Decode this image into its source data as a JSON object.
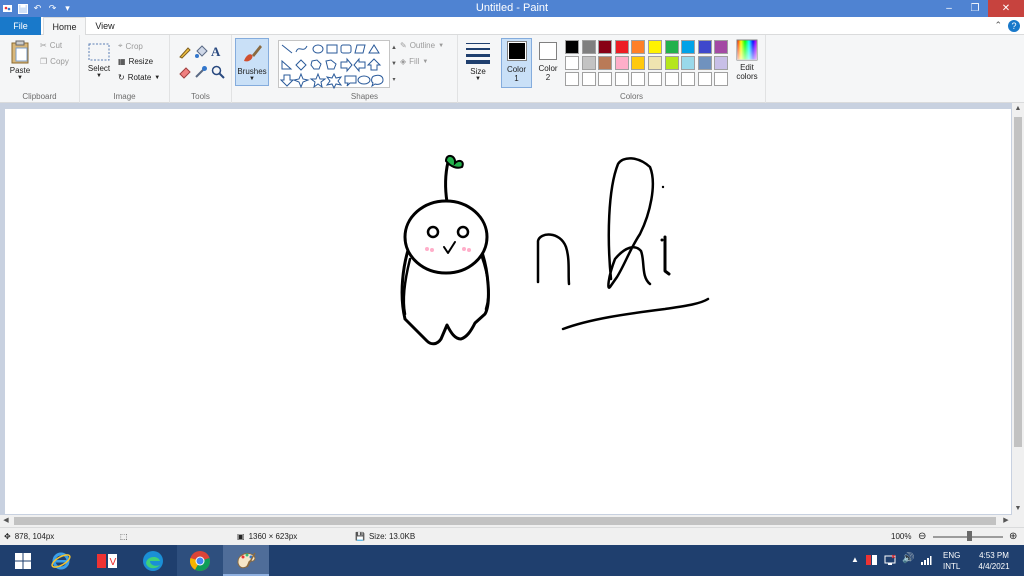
{
  "window": {
    "title": "Untitled - Paint"
  },
  "tabs": {
    "file": "File",
    "home": "Home",
    "view": "View"
  },
  "ribbon": {
    "clipboard": {
      "label": "Clipboard",
      "paste": "Paste",
      "cut": "Cut",
      "copy": "Copy"
    },
    "image": {
      "label": "Image",
      "select": "Select",
      "crop": "Crop",
      "resize": "Resize",
      "rotate": "Rotate"
    },
    "tools": {
      "label": "Tools"
    },
    "brushes": {
      "label": "Brushes"
    },
    "shapes": {
      "label": "Shapes",
      "outline": "Outline",
      "fill": "Fill"
    },
    "size": {
      "label": "Size"
    },
    "colors": {
      "label": "Colors",
      "color1_label": "Color",
      "color1_num": "1",
      "color2_label": "Color",
      "color2_num": "2",
      "color1_value": "#000000",
      "color2_value": "#ffffff",
      "edit_colors_1": "Edit",
      "edit_colors_2": "colors",
      "palette": [
        "#000000",
        "#7f7f7f",
        "#880015",
        "#ed1c24",
        "#ff7f27",
        "#fff200",
        "#22b14c",
        "#00a2e8",
        "#3f48cc",
        "#a349a4",
        "#ffffff",
        "#c3c3c3",
        "#b97a57",
        "#ffaec9",
        "#ffc90e",
        "#efe4b0",
        "#b5e61d",
        "#99d9ea",
        "#7092be",
        "#c8bfe7",
        "#ffffff",
        "#ffffff",
        "#ffffff",
        "#ffffff",
        "#ffffff",
        "#ffffff",
        "#ffffff",
        "#ffffff",
        "#ffffff",
        "#ffffff"
      ]
    }
  },
  "drawing": {
    "ink_color": "#000000",
    "sprout_color": "#22b14c",
    "blush_color": "#ffaec9"
  },
  "status": {
    "cursor_pos": "878, 104px",
    "canvas_size": "1360 × 623px",
    "file_size": "Size: 13.0KB",
    "zoom": "100%"
  },
  "taskbar": {
    "tray_lang_1": "ENG",
    "tray_lang_2": "INTL",
    "time": "4:53 PM",
    "date": "4/4/2021"
  }
}
